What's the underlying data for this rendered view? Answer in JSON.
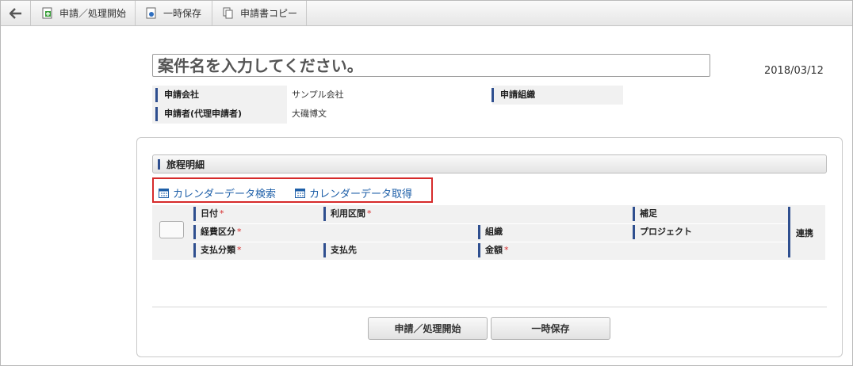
{
  "toolbar": {
    "back_icon": "arrow-left-icon",
    "items": [
      {
        "label": "申請／処理開始",
        "icon": "add-document-icon"
      },
      {
        "label": "一時保存",
        "icon": "save-document-icon"
      },
      {
        "label": "申請書コピー",
        "icon": "copy-icon"
      }
    ]
  },
  "header": {
    "title_placeholder": "案件名を入力してください。",
    "date": "2018/03/12",
    "fields": {
      "company_label": "申請会社",
      "company_value": "サンプル会社",
      "org_label": "申請組織",
      "org_value": "",
      "applicant_label": "申請者(代理申請者)",
      "applicant_value": "大磯博文"
    }
  },
  "section": {
    "title": "旅程明細",
    "calendar_links": [
      "カレンダーデータ検索",
      "カレンダーデータ取得"
    ],
    "columns": {
      "date": "日付",
      "route": "利用区間",
      "note": "補足",
      "expense_type": "経費区分",
      "org": "組織",
      "project": "プロジェクト",
      "payment_type": "支払分類",
      "payee": "支払先",
      "amount": "金額",
      "link": "連携",
      "required_mark": "*"
    }
  },
  "footer": {
    "submit_label": "申請／処理開始",
    "save_label": "一時保存"
  },
  "colors": {
    "accent_bar": "#2f4f8f",
    "link": "#1e5fa8",
    "highlight": "#d62b2b"
  }
}
